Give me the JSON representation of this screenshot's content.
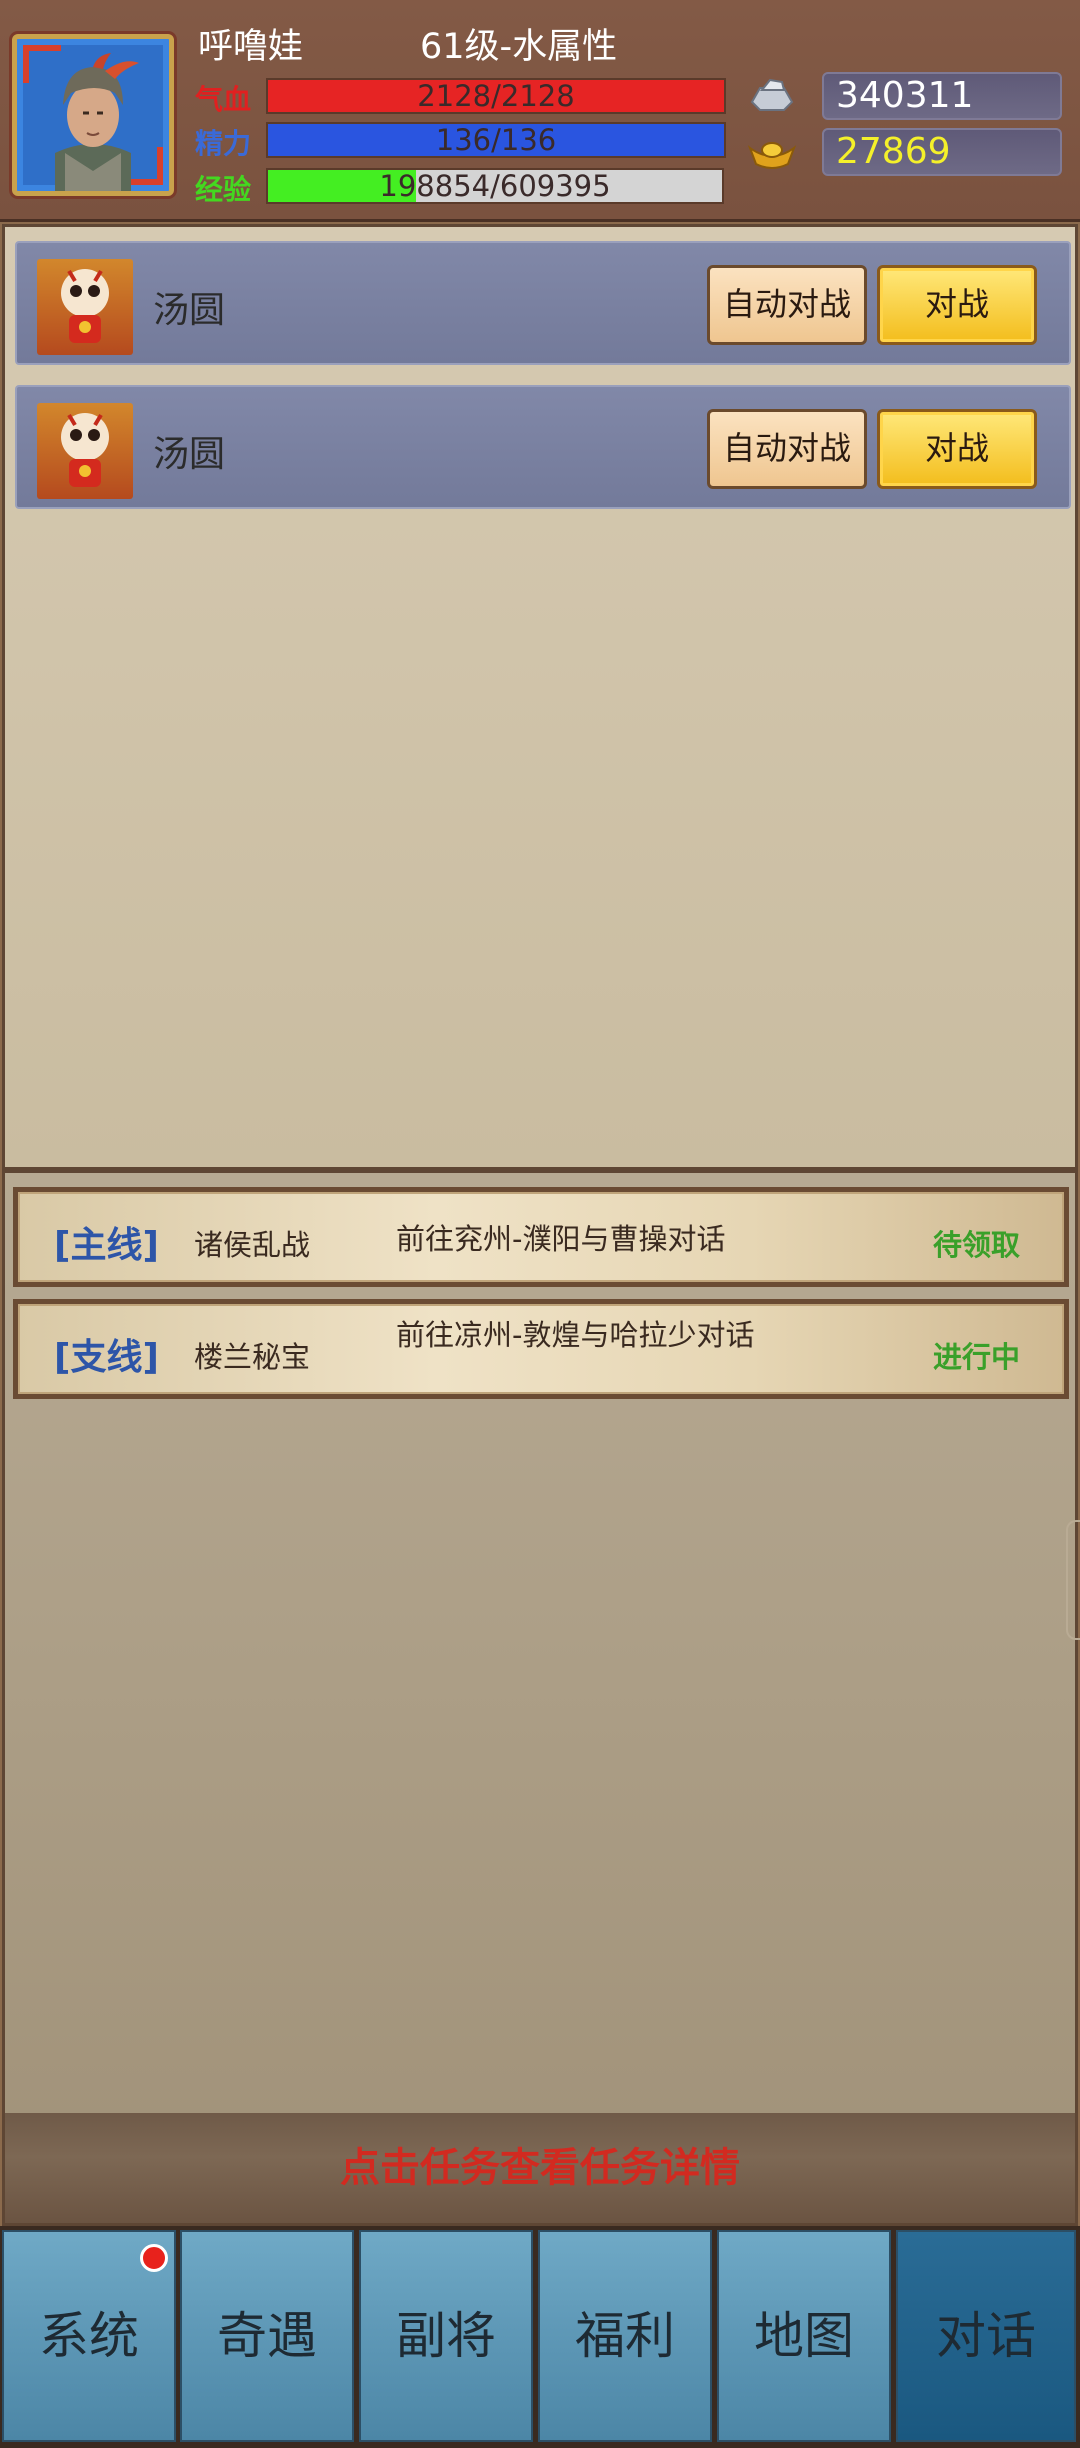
{
  "player": {
    "name": "呼噜娃",
    "level": "61级-水属性"
  },
  "stats": {
    "hp": {
      "label": "气血",
      "text": "2128/2128",
      "fraction": 1.0,
      "color": "#e62424",
      "label_color": "#e02020"
    },
    "mp": {
      "label": "精力",
      "text": "136/136",
      "fraction": 1.0,
      "color": "#2a55e0",
      "label_color": "#3a6ad8"
    },
    "exp": {
      "label": "经验",
      "text": "198854/609395",
      "fraction": 0.326,
      "color": "#44ee22",
      "label_color": "#44d820"
    }
  },
  "currency": {
    "silver": {
      "icon": "silver-ingot-icon",
      "value": "340311",
      "color": "#ffffff"
    },
    "gold": {
      "icon": "gold-ingot-icon",
      "value": "27869",
      "color": "#f4f02a"
    }
  },
  "enemies": [
    {
      "name": "汤圆",
      "auto_label": "自动对战",
      "fight_label": "对战"
    },
    {
      "name": "汤圆",
      "auto_label": "自动对战",
      "fight_label": "对战"
    }
  ],
  "quests": [
    {
      "type": "[主线]",
      "name": "诸侯乱战",
      "desc": "前往兖州-濮阳与曹操对话",
      "status": "待领取"
    },
    {
      "type": "[支线]",
      "name": "楼兰秘宝",
      "desc": "前往凉州-敦煌与哈拉少对话",
      "status": "进行中"
    }
  ],
  "hint": "点击任务查看任务详情",
  "nav": [
    {
      "label": "系统",
      "badge": true
    },
    {
      "label": "奇遇"
    },
    {
      "label": "副将"
    },
    {
      "label": "福利"
    },
    {
      "label": "地图"
    },
    {
      "label": "对话",
      "active": true
    }
  ]
}
